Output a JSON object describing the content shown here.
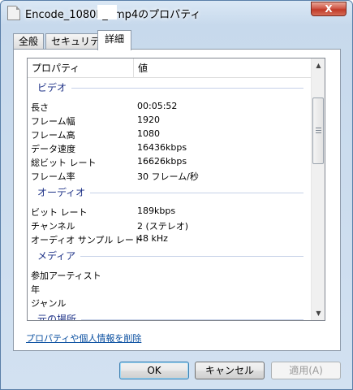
{
  "window": {
    "title": "Encode_1080P_    .mp4のプロパティ",
    "close_label": "X"
  },
  "tabs": [
    {
      "label": "全般",
      "active": false
    },
    {
      "label": "セキュリティ",
      "active": false
    },
    {
      "label": "詳細",
      "active": true
    }
  ],
  "list": {
    "headers": {
      "property": "プロパティ",
      "value": "値"
    },
    "groups": {
      "video": "ビデオ",
      "audio": "オーディオ",
      "media": "メディア",
      "origin": "元の場所"
    },
    "video_rows": [
      {
        "k": "長さ",
        "v": "00:05:52"
      },
      {
        "k": "フレーム幅",
        "v": "1920"
      },
      {
        "k": "フレーム高",
        "v": "1080"
      },
      {
        "k": "データ速度",
        "v": "16436kbps"
      },
      {
        "k": "総ビット レート",
        "v": "16626kbps"
      },
      {
        "k": "フレーム率",
        "v": "30 フレーム/秒"
      }
    ],
    "audio_rows": [
      {
        "k": "ビット レート",
        "v": "189kbps"
      },
      {
        "k": "チャンネル",
        "v": "2 (ステレオ)"
      },
      {
        "k": "オーディオ サンプル レート",
        "v": "48 kHz"
      }
    ],
    "media_rows": [
      {
        "k": "参加アーティスト",
        "v": ""
      },
      {
        "k": "年",
        "v": ""
      },
      {
        "k": "ジャンル",
        "v": ""
      }
    ]
  },
  "remove_link": "プロパティや個人情報を削除",
  "buttons": {
    "ok": "OK",
    "cancel": "キャンセル",
    "apply": "適用(A)"
  }
}
